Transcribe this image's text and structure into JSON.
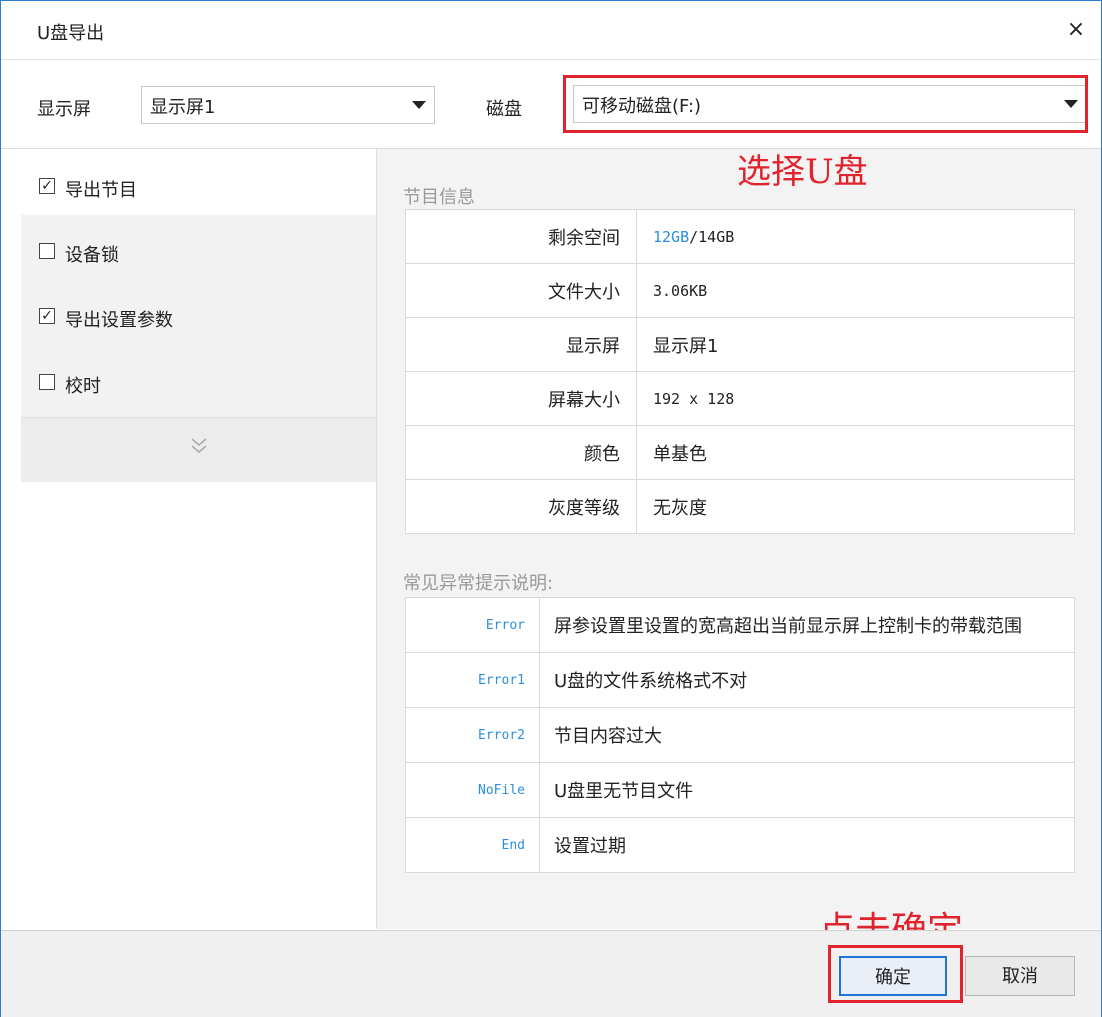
{
  "window": {
    "title": "U盘导出",
    "close": "×"
  },
  "toolbar": {
    "display_label": "显示屏",
    "display_value": "显示屏1",
    "disk_label": "磁盘",
    "disk_value": "可移动磁盘(F:)"
  },
  "options": {
    "items": [
      {
        "label": "导出节目",
        "checked": true
      },
      {
        "label": "设备锁",
        "checked": false
      },
      {
        "label": "导出设置参数",
        "checked": true
      },
      {
        "label": "校时",
        "checked": false
      }
    ]
  },
  "program_info": {
    "title": "节目信息",
    "rows": [
      {
        "key": "剩余空间",
        "free": "12GB",
        "total": "/14GB"
      },
      {
        "key": "文件大小",
        "value": "3.06KB"
      },
      {
        "key": "显示屏",
        "value": "显示屏1"
      },
      {
        "key": "屏幕大小",
        "value": "192 x 128"
      },
      {
        "key": "颜色",
        "value": "单基色"
      },
      {
        "key": "灰度等级",
        "value": "无灰度"
      }
    ]
  },
  "errors": {
    "title": "常见异常提示说明:",
    "rows": [
      {
        "code": "Error",
        "desc": "屏参设置里设置的宽高超出当前显示屏上控制卡的带载范围"
      },
      {
        "code": "Error1",
        "desc": "U盘的文件系统格式不对"
      },
      {
        "code": "Error2",
        "desc": "节目内容过大"
      },
      {
        "code": "NoFile",
        "desc": "U盘里无节目文件"
      },
      {
        "code": "End",
        "desc": "设置过期"
      }
    ]
  },
  "annotations": {
    "select_disk": "选择U盘",
    "click_ok": "点击确定"
  },
  "footer": {
    "ok_label": "确定",
    "cancel_label": "取消"
  },
  "colors": {
    "accent": "#2b8ee0",
    "annotation": "#e0232c",
    "ok_border": "#1f74d4"
  }
}
